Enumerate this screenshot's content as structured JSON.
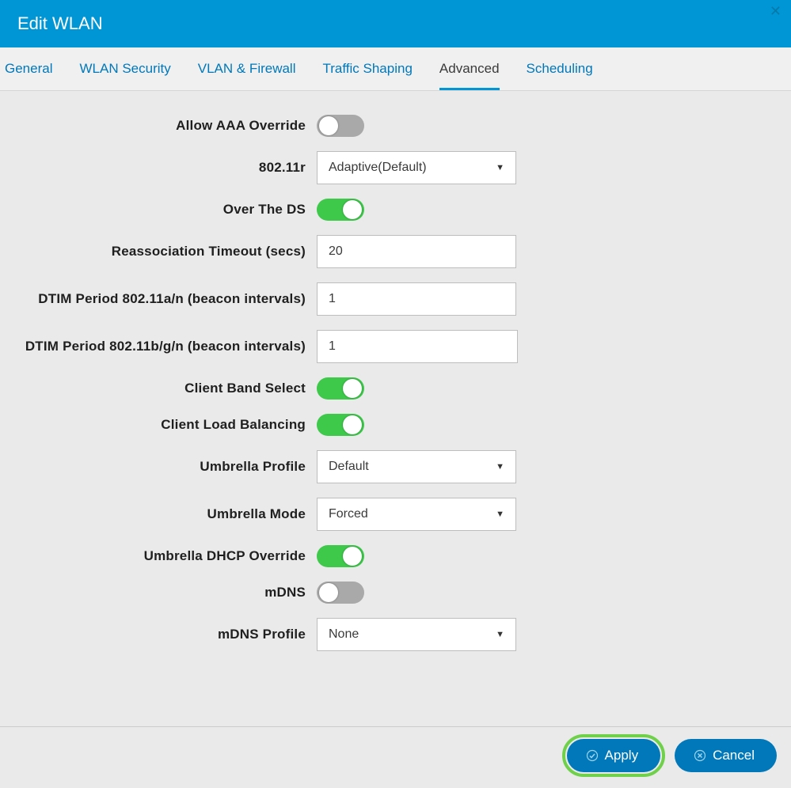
{
  "header": {
    "title": "Edit WLAN"
  },
  "tabs": [
    {
      "label": "General",
      "active": false
    },
    {
      "label": "WLAN Security",
      "active": false
    },
    {
      "label": "VLAN & Firewall",
      "active": false
    },
    {
      "label": "Traffic Shaping",
      "active": false
    },
    {
      "label": "Advanced",
      "active": true
    },
    {
      "label": "Scheduling",
      "active": false
    }
  ],
  "form": {
    "allow_aaa_override": {
      "label": "Allow AAA Override",
      "value": false
    },
    "r_80211": {
      "label": "802.11r",
      "value": "Adaptive(Default)"
    },
    "over_the_ds": {
      "label": "Over The DS",
      "value": true
    },
    "reassociation_timeout": {
      "label": "Reassociation Timeout (secs)",
      "value": "20"
    },
    "dtim_an": {
      "label": "DTIM Period 802.11a/n (beacon intervals)",
      "value": "1"
    },
    "dtim_bgn": {
      "label": "DTIM Period 802.11b/g/n (beacon intervals)",
      "value": "1"
    },
    "client_band_select": {
      "label": "Client Band Select",
      "value": true
    },
    "client_load_balancing": {
      "label": "Client Load Balancing",
      "value": true
    },
    "umbrella_profile": {
      "label": "Umbrella Profile",
      "value": "Default"
    },
    "umbrella_mode": {
      "label": "Umbrella Mode",
      "value": "Forced"
    },
    "umbrella_dhcp_override": {
      "label": "Umbrella DHCP Override",
      "value": true
    },
    "mdns": {
      "label": "mDNS",
      "value": false
    },
    "mdns_profile": {
      "label": "mDNS Profile",
      "value": "None"
    }
  },
  "footer": {
    "apply": "Apply",
    "cancel": "Cancel"
  }
}
